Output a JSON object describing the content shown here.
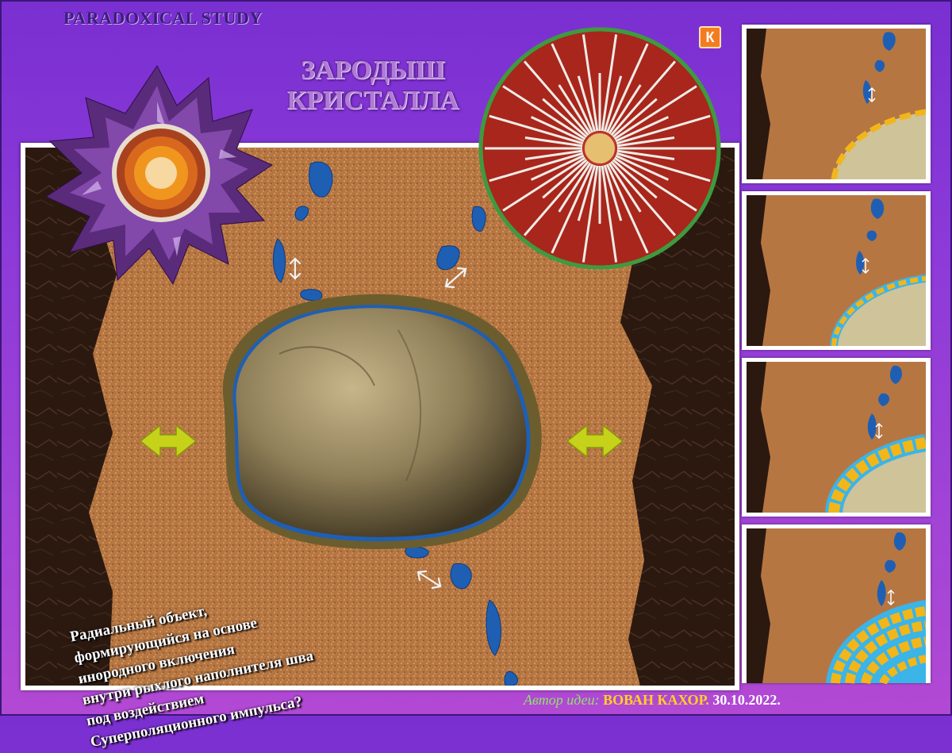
{
  "header": {
    "brand": "PARADOXICAL STUDY",
    "title_line1": "ЗАРОДЫШ",
    "title_line2": "КРИСТАЛЛА"
  },
  "logo": {
    "letter": "К"
  },
  "description": {
    "lines": [
      "Радиальный объект,",
      "формирующийся на основе",
      "инородного включения",
      "внутри рыхлого наполнителя шва",
      "под воздействием",
      "Суперполяционного импульса?"
    ]
  },
  "credit": {
    "label": "Автор идеи:",
    "author": "ВОВАН КАХОР.",
    "date": "30.10.2022."
  },
  "colors": {
    "background": "#8c3ad8",
    "sand": "#b87a45",
    "rock": "#2a1810",
    "water": "#1f5fb3",
    "crystal_gold": "#f2b619",
    "crystal_blue": "#3bb4e8",
    "arrow_yellow": "#c6d21a",
    "radial_red": "#a8261c",
    "radial_ring": "#3f9a3f"
  },
  "icons": [
    "amethyst-geode-image",
    "radial-crystal-diagram",
    "boulder-image",
    "double-arrow-icon"
  ]
}
